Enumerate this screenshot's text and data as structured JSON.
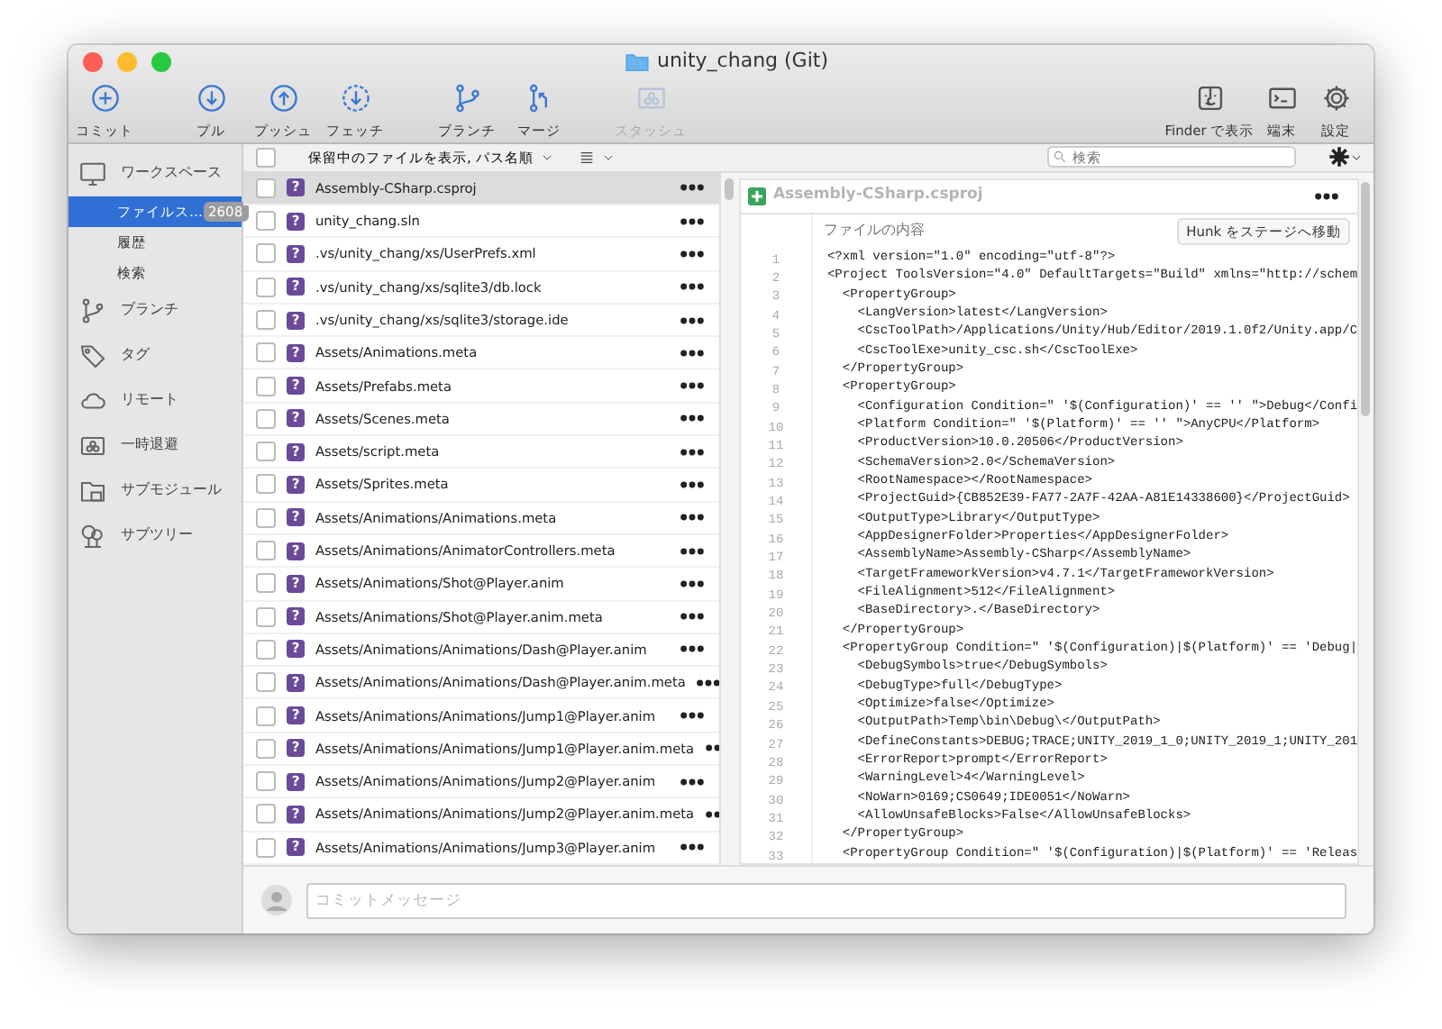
{
  "window": {
    "title": "unity_chang (Git)"
  },
  "toolbar": {
    "left": [
      {
        "label": "コミット",
        "disabled": false
      },
      {
        "label": "プル",
        "disabled": false
      },
      {
        "label": "プッシュ",
        "disabled": false
      },
      {
        "label": "フェッチ",
        "disabled": false
      },
      {
        "label": "ブランチ",
        "disabled": false
      },
      {
        "label": "マージ",
        "disabled": false
      },
      {
        "label": "スタッシュ",
        "disabled": true
      }
    ],
    "right": [
      {
        "label": "Finder で表示",
        "disabled": false
      },
      {
        "label": "端末",
        "disabled": false
      },
      {
        "label": "設定",
        "disabled": false
      }
    ]
  },
  "sidebar": {
    "sections": [
      {
        "label": "ワークスペース",
        "items": [
          {
            "label": "ファイルス…",
            "badge": "2608",
            "selected": true
          },
          {
            "label": "履歴",
            "selected": false
          },
          {
            "label": "検索",
            "selected": false
          }
        ]
      },
      {
        "label": "ブランチ"
      },
      {
        "label": "タグ"
      },
      {
        "label": "リモート"
      },
      {
        "label": "一時退避"
      },
      {
        "label": "サブモジュール"
      },
      {
        "label": "サブツリー"
      }
    ]
  },
  "file_header": {
    "checked": false,
    "filter": "保留中のファイルを表示, パス名順"
  },
  "search": {
    "placeholder": "検索"
  },
  "files": [
    {
      "name": "Assembly-CSharp.csproj",
      "status": "?",
      "checked": false,
      "selected": true
    },
    {
      "name": "unity_chang.sln",
      "status": "?",
      "checked": false,
      "selected": false
    },
    {
      "name": ".vs/unity_chang/xs/UserPrefs.xml",
      "status": "?",
      "checked": false,
      "selected": false
    },
    {
      "name": ".vs/unity_chang/xs/sqlite3/db.lock",
      "status": "?",
      "checked": false,
      "selected": false
    },
    {
      "name": ".vs/unity_chang/xs/sqlite3/storage.ide",
      "status": "?",
      "checked": false,
      "selected": false
    },
    {
      "name": "Assets/Animations.meta",
      "status": "?",
      "checked": false,
      "selected": false
    },
    {
      "name": "Assets/Prefabs.meta",
      "status": "?",
      "checked": false,
      "selected": false
    },
    {
      "name": "Assets/Scenes.meta",
      "status": "?",
      "checked": false,
      "selected": false
    },
    {
      "name": "Assets/script.meta",
      "status": "?",
      "checked": false,
      "selected": false
    },
    {
      "name": "Assets/Sprites.meta",
      "status": "?",
      "checked": false,
      "selected": false
    },
    {
      "name": "Assets/Animations/Animations.meta",
      "status": "?",
      "checked": false,
      "selected": false
    },
    {
      "name": "Assets/Animations/AnimatorControllers.meta",
      "status": "?",
      "checked": false,
      "selected": false
    },
    {
      "name": "Assets/Animations/Shot@Player.anim",
      "status": "?",
      "checked": false,
      "selected": false
    },
    {
      "name": "Assets/Animations/Shot@Player.anim.meta",
      "status": "?",
      "checked": false,
      "selected": false
    },
    {
      "name": "Assets/Animations/Animations/Dash@Player.anim",
      "status": "?",
      "checked": false,
      "selected": false
    },
    {
      "name": "Assets/Animations/Animations/Dash@Player.anim.meta",
      "status": "?",
      "checked": false,
      "selected": false
    },
    {
      "name": "Assets/Animations/Animations/Jump1@Player.anim",
      "status": "?",
      "checked": false,
      "selected": false
    },
    {
      "name": "Assets/Animations/Animations/Jump1@Player.anim.meta",
      "status": "?",
      "checked": false,
      "selected": false
    },
    {
      "name": "Assets/Animations/Animations/Jump2@Player.anim",
      "status": "?",
      "checked": false,
      "selected": false
    },
    {
      "name": "Assets/Animations/Animations/Jump2@Player.anim.meta",
      "status": "?",
      "checked": false,
      "selected": false
    },
    {
      "name": "Assets/Animations/Animations/Jump3@Player.anim",
      "status": "?",
      "checked": false,
      "selected": false
    }
  ],
  "diff": {
    "file_name": "Assembly-CSharp.csproj",
    "caption": "ファイルの内容",
    "stage_button": "Hunk をステージへ移動",
    "lines": [
      {
        "number": "1",
        "text": "<?xml version=\"1.0\" encoding=\"utf-8\"?>"
      },
      {
        "number": "2",
        "text": "<Project ToolsVersion=\"4.0\" DefaultTargets=\"Build\" xmlns=\"http://schem"
      },
      {
        "number": "3",
        "text": "  <PropertyGroup>"
      },
      {
        "number": "4",
        "text": "    <LangVersion>latest</LangVersion>"
      },
      {
        "number": "5",
        "text": "    <CscToolPath>/Applications/Unity/Hub/Editor/2019.1.0f2/Unity.app/C"
      },
      {
        "number": "6",
        "text": "    <CscToolExe>unity_csc.sh</CscToolExe>"
      },
      {
        "number": "7",
        "text": "  </PropertyGroup>"
      },
      {
        "number": "8",
        "text": "  <PropertyGroup>"
      },
      {
        "number": "9",
        "text": "    <Configuration Condition=\" '$(Configuration)' == '' \">Debug</Confi"
      },
      {
        "number": "10",
        "text": "    <Platform Condition=\" '$(Platform)' == '' \">AnyCPU</Platform>"
      },
      {
        "number": "11",
        "text": "    <ProductVersion>10.0.20506</ProductVersion>"
      },
      {
        "number": "12",
        "text": "    <SchemaVersion>2.0</SchemaVersion>"
      },
      {
        "number": "13",
        "text": "    <RootNamespace></RootNamespace>"
      },
      {
        "number": "14",
        "text": "    <ProjectGuid>{CB852E39-FA77-2A7F-42AA-A81E14338600}</ProjectGuid>"
      },
      {
        "number": "15",
        "text": "    <OutputType>Library</OutputType>"
      },
      {
        "number": "16",
        "text": "    <AppDesignerFolder>Properties</AppDesignerFolder>"
      },
      {
        "number": "17",
        "text": "    <AssemblyName>Assembly-CSharp</AssemblyName>"
      },
      {
        "number": "18",
        "text": "    <TargetFrameworkVersion>v4.7.1</TargetFrameworkVersion>"
      },
      {
        "number": "19",
        "text": "    <FileAlignment>512</FileAlignment>"
      },
      {
        "number": "20",
        "text": "    <BaseDirectory>.</BaseDirectory>"
      },
      {
        "number": "21",
        "text": "  </PropertyGroup>"
      },
      {
        "number": "22",
        "text": "  <PropertyGroup Condition=\" '$(Configuration)|$(Platform)' == 'Debug|"
      },
      {
        "number": "23",
        "text": "    <DebugSymbols>true</DebugSymbols>"
      },
      {
        "number": "24",
        "text": "    <DebugType>full</DebugType>"
      },
      {
        "number": "25",
        "text": "    <Optimize>false</Optimize>"
      },
      {
        "number": "26",
        "text": "    <OutputPath>Temp\\bin\\Debug\\</OutputPath>"
      },
      {
        "number": "27",
        "text": "    <DefineConstants>DEBUG;TRACE;UNITY_2019_1_0;UNITY_2019_1;UNITY_201"
      },
      {
        "number": "28",
        "text": "    <ErrorReport>prompt</ErrorReport>"
      },
      {
        "number": "29",
        "text": "    <WarningLevel>4</WarningLevel>"
      },
      {
        "number": "30",
        "text": "    <NoWarn>0169;CS0649;IDE0051</NoWarn>"
      },
      {
        "number": "31",
        "text": "    <AllowUnsafeBlocks>False</AllowUnsafeBlocks>"
      },
      {
        "number": "32",
        "text": "  </PropertyGroup>"
      },
      {
        "number": "33",
        "text": "  <PropertyGroup Condition=\" '$(Configuration)|$(Platform)' == 'Releas"
      }
    ]
  },
  "commit": {
    "placeholder": "コミットメッセージ"
  }
}
